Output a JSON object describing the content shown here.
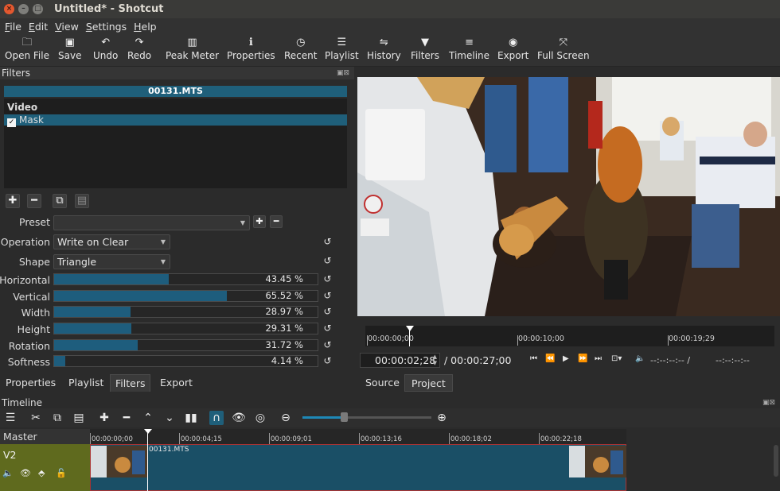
{
  "window": {
    "title": "Untitled* - Shotcut"
  },
  "menu": [
    "File",
    "Edit",
    "View",
    "Settings",
    "Help"
  ],
  "toolbar": [
    {
      "label": "Open File",
      "icon": "folder-icon"
    },
    {
      "label": "Save",
      "icon": "save-icon"
    },
    {
      "label": "Undo",
      "icon": "undo-icon"
    },
    {
      "label": "Redo",
      "icon": "redo-icon"
    },
    {
      "label": "Peak Meter",
      "icon": "peak-meter-icon"
    },
    {
      "label": "Properties",
      "icon": "info-icon"
    },
    {
      "label": "Recent",
      "icon": "clock-icon"
    },
    {
      "label": "Playlist",
      "icon": "list-icon"
    },
    {
      "label": "History",
      "icon": "history-icon"
    },
    {
      "label": "Filters",
      "icon": "funnel-icon"
    },
    {
      "label": "Timeline",
      "icon": "timeline-icon"
    },
    {
      "label": "Export",
      "icon": "export-icon"
    },
    {
      "label": "Full Screen",
      "icon": "fullscreen-icon"
    }
  ],
  "filters": {
    "panel_title": "Filters",
    "clip_name": "00131.MTS",
    "group": "Video",
    "items": [
      {
        "label": "Mask",
        "checked": true
      }
    ],
    "preset_label": "Preset",
    "preset_value": "",
    "operation": {
      "label": "Operation",
      "value": "Write on Clear"
    },
    "shape": {
      "label": "Shape",
      "value": "Triangle"
    },
    "sliders": [
      {
        "label": "Horizontal",
        "value": 43.45,
        "text": "43.45 %"
      },
      {
        "label": "Vertical",
        "value": 65.52,
        "text": "65.52 %"
      },
      {
        "label": "Width",
        "value": 28.97,
        "text": "28.97 %"
      },
      {
        "label": "Height",
        "value": 29.31,
        "text": "29.31 %"
      },
      {
        "label": "Rotation",
        "value": 31.72,
        "text": "31.72 %"
      },
      {
        "label": "Softness",
        "value": 4.14,
        "text": "4.14 %"
      }
    ]
  },
  "left_tabs": [
    "Properties",
    "Playlist",
    "Filters",
    "Export"
  ],
  "left_tab_active": "Filters",
  "player": {
    "ruler_labels": [
      "00:00:00;00",
      "00:00:10;00",
      "00:00:19;29"
    ],
    "timecode": "00:00:02;28",
    "total": "/ 00:00:27;00",
    "in_point": "--:--:--:-- /",
    "duration": "--:--:--:--",
    "tabs": [
      "Source",
      "Project"
    ],
    "active_tab": "Project"
  },
  "timeline": {
    "panel_title": "Timeline",
    "master_label": "Master",
    "track": "V2",
    "ruler_labels": [
      "00:00:00;00",
      "00:00:04;15",
      "00:00:09;01",
      "00:00:13;16",
      "00:00:18;02",
      "00:00:22;18"
    ],
    "clip_label": "00131.MTS",
    "zoom": 0.32
  },
  "colors": {
    "accent": "#1f5f7a",
    "track_header": "#5f6a1e",
    "clip_border": "#aa3333"
  }
}
